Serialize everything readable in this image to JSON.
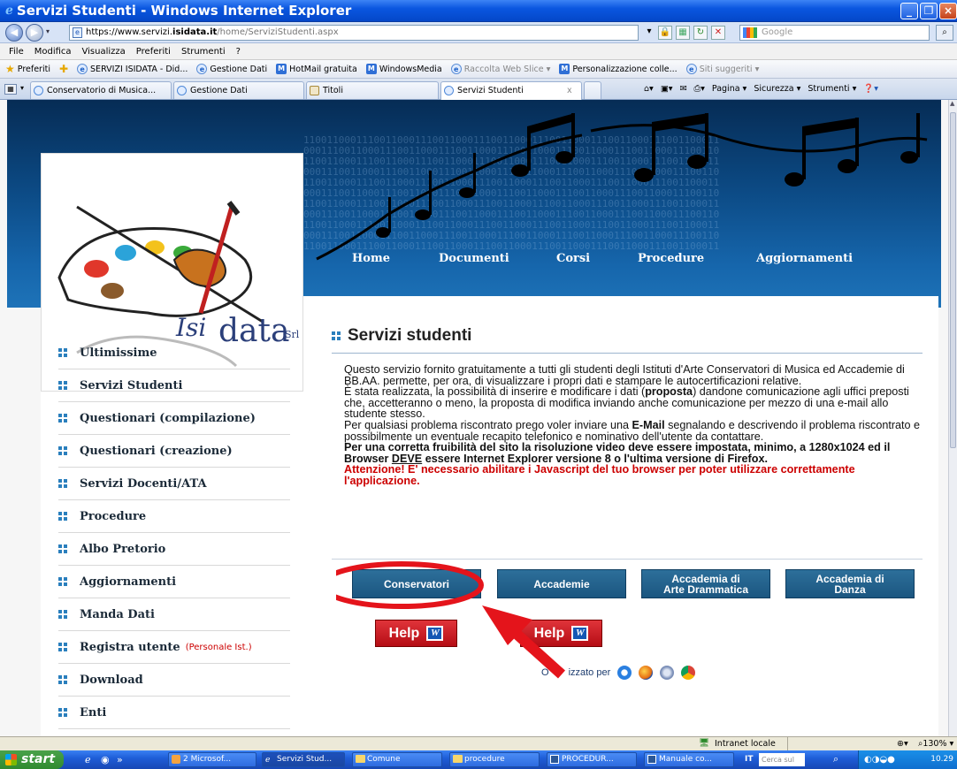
{
  "window": {
    "title": "Servizi Studenti - Windows Internet Explorer"
  },
  "address": {
    "url_prefix": "https://www.servizi.",
    "url_host": "isidata.it",
    "url_path": "/home/ServiziStudenti.aspx",
    "search_placeholder": "Google"
  },
  "menu": [
    "File",
    "Modifica",
    "Visualizza",
    "Preferiti",
    "Strumenti",
    "?"
  ],
  "favorites": {
    "label": "Preferiti",
    "items": [
      "SERVIZI ISIDATA - Did...",
      "Gestione Dati",
      "HotMail gratuita",
      "WindowsMedia",
      "Raccolta Web Slice ▾",
      "Personalizzazione colle...",
      "Siti suggeriti ▾"
    ]
  },
  "tabs": [
    {
      "label": "Conservatorio di Musica..."
    },
    {
      "label": "Gestione Dati"
    },
    {
      "label": "Titoli"
    },
    {
      "label": "Servizi Studenti",
      "close": "x"
    }
  ],
  "commandbar": {
    "page": "Pagina ▾",
    "security": "Sicurezza ▾",
    "tools": "Strumenti ▾"
  },
  "site": {
    "logo_text": "data",
    "logo_script": "Isi",
    "logo_srl": "Srl",
    "nav": [
      "Home",
      "Documenti",
      "Corsi",
      "Procedure",
      "Aggiornamenti"
    ],
    "sidebar": [
      {
        "label": "Ultimissime"
      },
      {
        "label": "Servizi Studenti"
      },
      {
        "label": "Questionari (compilazione)"
      },
      {
        "label": "Questionari (creazione)"
      },
      {
        "label": "Servizi Docenti/ATA"
      },
      {
        "label": "Procedure"
      },
      {
        "label": "Albo Pretorio"
      },
      {
        "label": "Aggiornamenti"
      },
      {
        "label": "Manda Dati"
      },
      {
        "label": "Registra utente",
        "note": "(Personale Ist.)"
      },
      {
        "label": "Download"
      },
      {
        "label": "Enti"
      }
    ],
    "heading": "Servizi studenti",
    "p1": "Questo servizio fornito gratuitamente a tutti gli studenti degli Istituti d'Arte Conservatori di Musica ed Accademie di BB.AA. permette, per ora, di visualizzare i propri dati e stampare le autocertificazioni relative.",
    "p2_a": "È stata realizzata, la possibilità di inserire e modificare i dati (",
    "p2_b": "proposta",
    "p2_c": ") dandone comunicazione agli uffici preposti che, accetteranno o meno, la proposta di modifica inviando anche comunicazione per mezzo di una e-mail allo studente stesso.",
    "p3_a": "Per qualsiasi problema riscontrato prego voler inviare una ",
    "p3_b": "E-Mail",
    "p3_c": " segnalando e descrivendo il problema riscontrato e possibilmente un eventuale recapito telefonico e nominativo dell'utente da contattare.",
    "p4_a": "Per una corretta fruibilità del sito la risoluzione video deve essere impostata, minimo, a 1280x1024 ed il Browser ",
    "p4_b": "DEVE",
    "p4_c": " essere Internet Explorer versione 8 o l'ultima versione di Firefox.",
    "p5": "Attenzione! E' necessario abilitare i Javascript del tuo browser per poter utilizzare correttamente l'applicazione.",
    "buttons": {
      "conservatori": "Conservatori",
      "accademie": "Accademie",
      "arte_line1": "Accademia di",
      "arte_line2": "Arte Drammatica",
      "danza_line1": "Accademia di",
      "danza_line2": "Danza"
    },
    "help": "Help",
    "help_icon": "W",
    "optimized_a": "O",
    "optimized_b": "izzato per"
  },
  "status": {
    "zone": "Intranet locale",
    "zoom": "130%"
  },
  "taskbar": {
    "start": "start",
    "tasks": [
      "2 Microsof...",
      "Servizi Stud...",
      "Comune",
      "procedure",
      "PROCEDUR...",
      "Manuale co..."
    ],
    "search": "Cerca sul PC",
    "search_prefix": "IT",
    "time": "10.29"
  },
  "colors": {
    "highlight": "#e4141b",
    "accent": "#2a7fbd",
    "warning": "#cc0000"
  }
}
